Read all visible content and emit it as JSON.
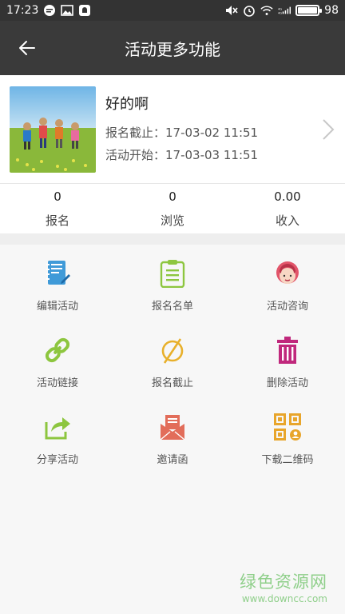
{
  "status_bar": {
    "time": "17:23",
    "battery": "98",
    "battery_level": 0.98,
    "icons": [
      "message-icon",
      "image-icon",
      "notification-icon",
      "mute-icon",
      "alarm-icon",
      "wifi-icon",
      "signal-icon",
      "battery-icon"
    ]
  },
  "header": {
    "title": "活动更多功能",
    "back_icon": "arrow-left-icon"
  },
  "event": {
    "title": "好的啊",
    "deadline_label": "报名截止：",
    "deadline_value": "17-03-02 11:51",
    "start_label": "活动开始：",
    "start_value": "17-03-03 11:51"
  },
  "stats": [
    {
      "value": "0",
      "label": "报名"
    },
    {
      "value": "0",
      "label": "浏览"
    },
    {
      "value": "0.00",
      "label": "收入"
    }
  ],
  "actions": [
    {
      "label": "编辑活动",
      "icon": "edit-notebook-icon",
      "color": "#3f9ad8"
    },
    {
      "label": "报名名单",
      "icon": "clipboard-list-icon",
      "color": "#8dc63f"
    },
    {
      "label": "活动咨询",
      "icon": "support-agent-icon",
      "color": "#e2556a"
    },
    {
      "label": "活动链接",
      "icon": "link-icon",
      "color": "#8dc63f"
    },
    {
      "label": "报名截止",
      "icon": "prohibited-icon",
      "color": "#e8b02b"
    },
    {
      "label": "删除活动",
      "icon": "trash-icon",
      "color": "#c0287c"
    },
    {
      "label": "分享活动",
      "icon": "share-icon",
      "color": "#8dc63f"
    },
    {
      "label": "邀请函",
      "icon": "envelope-icon",
      "color": "#e26d5a"
    },
    {
      "label": "下载二维码",
      "icon": "qr-code-icon",
      "color": "#e8a52b"
    }
  ],
  "watermark": {
    "brand": "绿色资源网",
    "url": "www.downcc.com"
  }
}
